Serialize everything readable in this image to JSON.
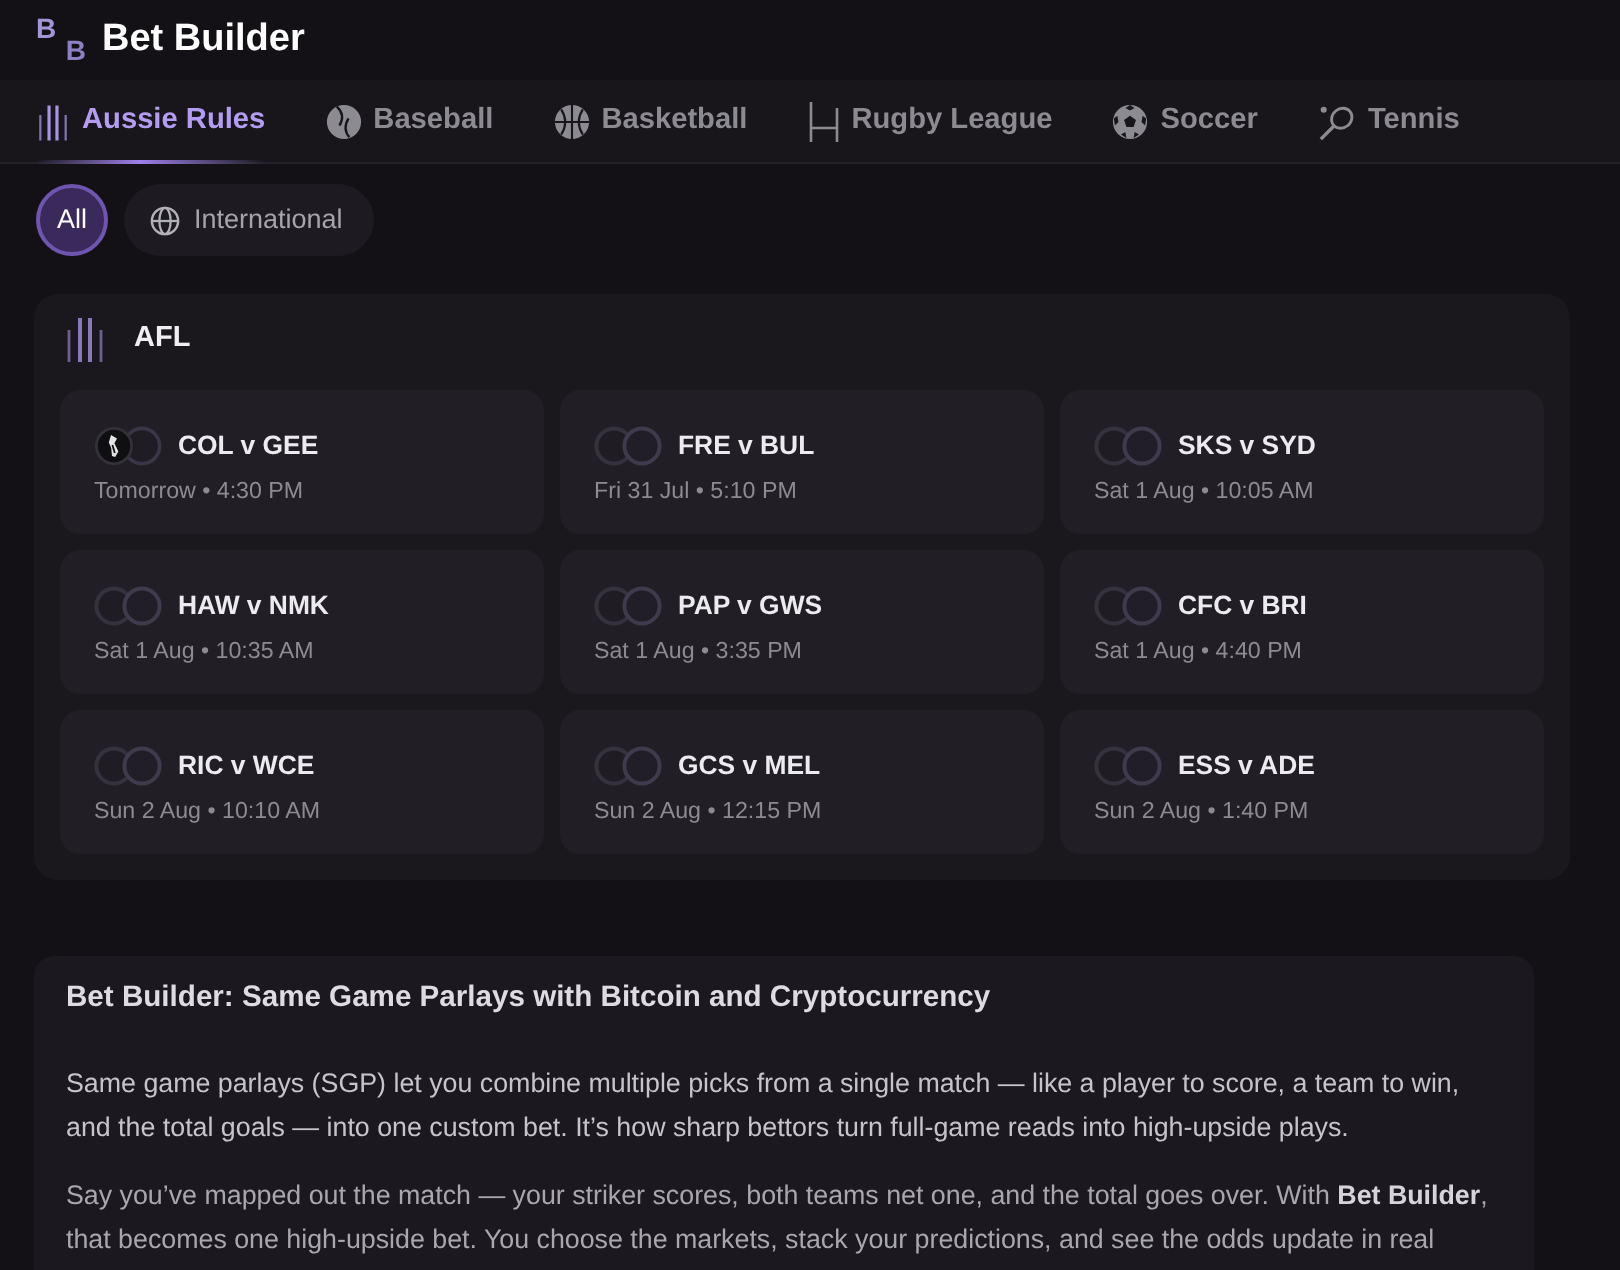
{
  "header": {
    "logo": [
      "B",
      "B"
    ],
    "title": "Bet Builder"
  },
  "sport_tabs": [
    {
      "kind": "afl",
      "label": "Aussie Rules",
      "selected": true
    },
    {
      "kind": "baseball",
      "label": "Baseball",
      "selected": false
    },
    {
      "kind": "basketball",
      "label": "Basketball",
      "selected": false
    },
    {
      "kind": "rugby",
      "label": "Rugby League",
      "selected": false
    },
    {
      "kind": "soccer",
      "label": "Soccer",
      "selected": false
    },
    {
      "kind": "tennis",
      "label": "Tennis",
      "selected": false
    }
  ],
  "filters": [
    {
      "kind": "plain",
      "label": "All",
      "selected": true
    },
    {
      "kind": "globe",
      "label": "International",
      "selected": false
    }
  ],
  "competition": {
    "kind": "afl",
    "title": "AFL",
    "matches": [
      {
        "kind": "crest",
        "teams": "COL v GEE",
        "time": "Tomorrow • 4:30 PM"
      },
      {
        "kind": "placeholder",
        "teams": "FRE v BUL",
        "time": "Fri 31 Jul • 5:10 PM"
      },
      {
        "kind": "placeholder",
        "teams": "SKS v SYD",
        "time": "Sat 1 Aug • 10:05 AM"
      },
      {
        "kind": "placeholder",
        "teams": "HAW v NMK",
        "time": "Sat 1 Aug • 10:35 AM"
      },
      {
        "kind": "placeholder",
        "teams": "PAP v GWS",
        "time": "Sat 1 Aug • 3:35 PM"
      },
      {
        "kind": "placeholder",
        "teams": "CFC v BRI",
        "time": "Sat 1 Aug • 4:40 PM"
      },
      {
        "kind": "placeholder",
        "teams": "RIC v WCE",
        "time": "Sun 2 Aug • 10:10 AM"
      },
      {
        "kind": "placeholder",
        "teams": "GCS v MEL",
        "time": "Sun 2 Aug • 12:15 PM"
      },
      {
        "kind": "placeholder",
        "teams": "ESS v ADE",
        "time": "Sun 2 Aug • 1:40 PM"
      }
    ]
  },
  "info": {
    "title": "Bet Builder: Same Game Parlays with Bitcoin and Cryptocurrency",
    "paragraphs": [
      "Same game parlays (SGP) let you combine multiple picks from a single match — like a player to score, a team to win, and the total goals — into one custom bet. It’s how sharp bettors turn full-game reads into high-upside plays.",
      "Say you’ve mapped out the match — your striker scores, both teams net one, and the total goes over. With **Bet Builder**, that becomes one high-upside bet. You choose the markets, stack your predictions, and see the odds update in real"
    ]
  }
}
